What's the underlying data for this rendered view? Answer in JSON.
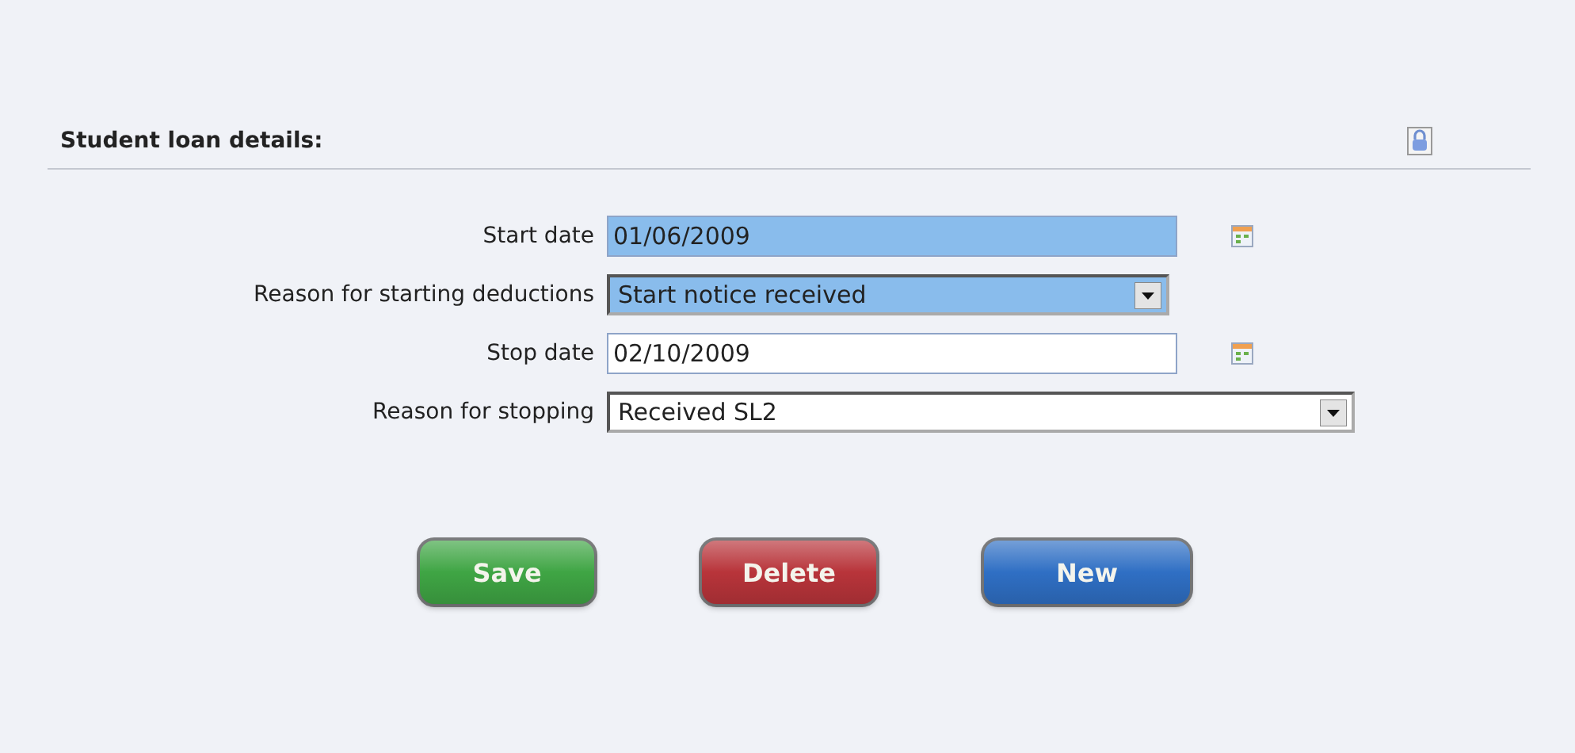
{
  "panel": {
    "title": "Student loan details:"
  },
  "fields": [
    {
      "label": "Start date",
      "kind": "date",
      "value": "01/06/2009",
      "highlighted": true
    },
    {
      "label": "Reason for starting deductions",
      "kind": "select",
      "value": "Start notice received",
      "highlighted": true
    },
    {
      "label": "Stop date",
      "kind": "date",
      "value": "02/10/2009",
      "highlighted": false
    },
    {
      "label": "Reason for stopping",
      "kind": "select",
      "value": "Received SL2",
      "highlighted": false
    }
  ],
  "buttons": [
    {
      "label": "Save",
      "color": "#3fa544"
    },
    {
      "label": "Delete",
      "color": "#b8343a"
    },
    {
      "label": "New",
      "color": "#2f6fc4"
    }
  ]
}
